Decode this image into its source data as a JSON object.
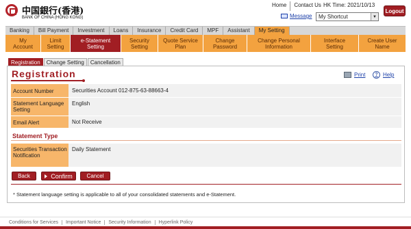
{
  "header": {
    "logo_cn": "中国銀行(香港)",
    "logo_en": "BANK OF CHINA (HONG KONG)",
    "home": "Home",
    "contact": "Contact Us",
    "hk_time": "HK Time: 2021/10/13",
    "logout": "Logout",
    "message": "Message",
    "shortcut": "My Shortcut"
  },
  "mainnav": [
    {
      "label": "Banking"
    },
    {
      "label": "Bill Payment"
    },
    {
      "label": "Investment"
    },
    {
      "label": "Loans"
    },
    {
      "label": "Insurance"
    },
    {
      "label": "Credit Card"
    },
    {
      "label": "MPF"
    },
    {
      "label": "Assistant"
    },
    {
      "label": "My Setting"
    }
  ],
  "subnav": [
    {
      "line1": "My",
      "line2": "Account"
    },
    {
      "line1": "Limit",
      "line2": "Setting"
    },
    {
      "line1": "e-Statement",
      "line2": "Setting"
    },
    {
      "line1": "Security",
      "line2": "Setting"
    },
    {
      "line1": "Quote Service",
      "line2": "Plan"
    },
    {
      "line1": "Change",
      "line2": "Password"
    },
    {
      "line1": "Change Personal",
      "line2": "Information"
    },
    {
      "line1": "Interface",
      "line2": "Setting"
    },
    {
      "line1": "Create User",
      "line2": "Name"
    }
  ],
  "tabs": [
    "Registration",
    "Change Setting",
    "Cancellation"
  ],
  "page": {
    "title": "Registration",
    "print": "Print",
    "help": "Help",
    "rows": [
      {
        "label": "Account Number",
        "value": "Securities Account 012-875-63-88663-4"
      },
      {
        "label": "Statement Language Setting",
        "value": "English"
      },
      {
        "label": "Email Alert",
        "value": "Not Receive"
      }
    ],
    "section_title": "Statement Type",
    "type_row": {
      "label": "Securities Transaction Notification",
      "value": "Daily Statement"
    },
    "back": "Back",
    "confirm": "Confirm",
    "cancel": "Cancel",
    "note": "* Statement language setting is applicable to all of your consolidated statements and e-Statement."
  },
  "footer": [
    "Conditions for Services",
    "Important Notice",
    "Security Information",
    "Hyperlink Policy"
  ],
  "colors": {
    "brand_red": "#a11e23",
    "orange": "#f3a23f",
    "label_orange": "#f7b66a"
  }
}
